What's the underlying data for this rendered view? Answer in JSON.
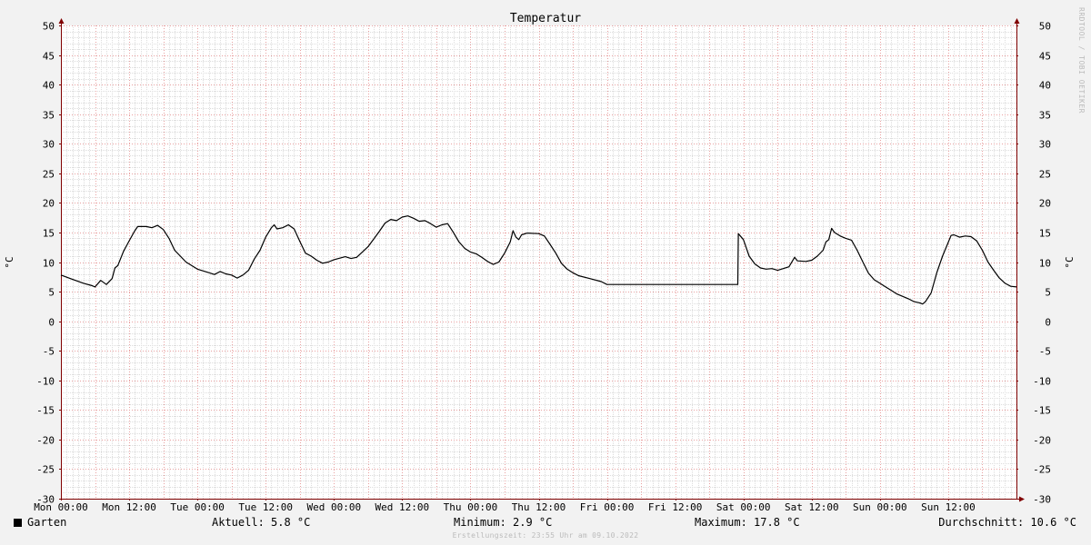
{
  "chart_data": {
    "type": "line",
    "title": "Temperatur",
    "ylabel": "°C",
    "ylabel_right": "°C",
    "ylim": [
      -30,
      50
    ],
    "y_ticks": [
      50,
      45,
      40,
      35,
      30,
      25,
      20,
      15,
      10,
      5,
      0,
      -5,
      -10,
      -15,
      -20,
      -25,
      -30
    ],
    "xlim": [
      0,
      168
    ],
    "x_ticks": [
      {
        "x": 0,
        "label": "Mon 00:00"
      },
      {
        "x": 12,
        "label": "Mon 12:00"
      },
      {
        "x": 24,
        "label": "Tue 00:00"
      },
      {
        "x": 36,
        "label": "Tue 12:00"
      },
      {
        "x": 48,
        "label": "Wed 00:00"
      },
      {
        "x": 60,
        "label": "Wed 12:00"
      },
      {
        "x": 72,
        "label": "Thu 00:00"
      },
      {
        "x": 84,
        "label": "Thu 12:00"
      },
      {
        "x": 96,
        "label": "Fri 00:00"
      },
      {
        "x": 108,
        "label": "Fri 12:00"
      },
      {
        "x": 120,
        "label": "Sat 00:00"
      },
      {
        "x": 132,
        "label": "Sat 12:00"
      },
      {
        "x": 144,
        "label": "Sun 00:00"
      },
      {
        "x": 156,
        "label": "Sun 12:00"
      }
    ],
    "grid": true,
    "series": [
      {
        "name": "Garten",
        "color": "#000000",
        "points": [
          [
            0,
            7.8
          ],
          [
            2,
            7.1
          ],
          [
            4,
            6.4
          ],
          [
            5.5,
            6.0
          ],
          [
            6,
            5.8
          ],
          [
            7,
            6.9
          ],
          [
            8,
            6.2
          ],
          [
            9,
            7.2
          ],
          [
            9.5,
            9.0
          ],
          [
            10,
            9.4
          ],
          [
            11,
            11.8
          ],
          [
            12,
            13.6
          ],
          [
            13,
            15.3
          ],
          [
            13.5,
            16.0
          ],
          [
            15,
            16.0
          ],
          [
            16,
            15.8
          ],
          [
            17,
            16.2
          ],
          [
            18,
            15.5
          ],
          [
            19,
            14.0
          ],
          [
            20,
            12.0
          ],
          [
            22,
            10.0
          ],
          [
            24,
            8.8
          ],
          [
            26,
            8.2
          ],
          [
            27,
            7.9
          ],
          [
            28,
            8.4
          ],
          [
            29,
            8.0
          ],
          [
            30,
            7.8
          ],
          [
            31,
            7.3
          ],
          [
            32,
            7.8
          ],
          [
            33,
            8.6
          ],
          [
            34,
            10.5
          ],
          [
            35,
            12.0
          ],
          [
            36,
            14.2
          ],
          [
            37,
            15.8
          ],
          [
            37.5,
            16.3
          ],
          [
            38,
            15.6
          ],
          [
            39,
            15.8
          ],
          [
            40,
            16.3
          ],
          [
            41,
            15.6
          ],
          [
            42,
            13.5
          ],
          [
            43,
            11.5
          ],
          [
            44,
            11.0
          ],
          [
            45,
            10.3
          ],
          [
            46,
            9.8
          ],
          [
            47,
            10.0
          ],
          [
            48,
            10.4
          ],
          [
            50,
            10.9
          ],
          [
            51,
            10.6
          ],
          [
            52,
            10.8
          ],
          [
            53,
            11.7
          ],
          [
            54,
            12.6
          ],
          [
            55,
            13.9
          ],
          [
            56,
            15.2
          ],
          [
            57,
            16.6
          ],
          [
            58,
            17.2
          ],
          [
            59,
            17.0
          ],
          [
            60,
            17.6
          ],
          [
            61,
            17.8
          ],
          [
            62,
            17.4
          ],
          [
            63,
            16.9
          ],
          [
            64,
            17.0
          ],
          [
            65,
            16.5
          ],
          [
            66,
            15.9
          ],
          [
            67,
            16.3
          ],
          [
            68,
            16.5
          ],
          [
            69,
            15.0
          ],
          [
            70,
            13.4
          ],
          [
            71,
            12.3
          ],
          [
            72,
            11.7
          ],
          [
            73,
            11.4
          ],
          [
            74,
            10.8
          ],
          [
            75,
            10.1
          ],
          [
            76,
            9.6
          ],
          [
            77,
            10.0
          ],
          [
            78,
            11.5
          ],
          [
            79,
            13.4
          ],
          [
            79.5,
            15.3
          ],
          [
            80,
            14.2
          ],
          [
            80.5,
            13.8
          ],
          [
            81,
            14.6
          ],
          [
            82,
            14.9
          ],
          [
            84,
            14.8
          ],
          [
            85,
            14.4
          ],
          [
            86,
            13.0
          ],
          [
            87,
            11.5
          ],
          [
            88,
            9.8
          ],
          [
            89,
            8.8
          ],
          [
            90,
            8.2
          ],
          [
            91,
            7.7
          ],
          [
            93,
            7.2
          ],
          [
            95,
            6.7
          ],
          [
            96,
            6.2
          ],
          [
            119,
            6.2
          ],
          [
            119.1,
            14.8
          ],
          [
            120,
            13.8
          ],
          [
            121,
            11.0
          ],
          [
            122,
            9.7
          ],
          [
            123,
            9.0
          ],
          [
            124,
            8.8
          ],
          [
            125,
            8.9
          ],
          [
            126,
            8.6
          ],
          [
            127,
            8.9
          ],
          [
            128,
            9.2
          ],
          [
            129,
            10.8
          ],
          [
            129.5,
            10.2
          ],
          [
            131,
            10.1
          ],
          [
            132,
            10.3
          ],
          [
            133,
            11.0
          ],
          [
            134,
            12.0
          ],
          [
            134.5,
            13.4
          ],
          [
            135,
            13.8
          ],
          [
            135.5,
            15.7
          ],
          [
            136,
            15.0
          ],
          [
            137,
            14.4
          ],
          [
            138,
            14.0
          ],
          [
            139,
            13.7
          ],
          [
            140,
            12.0
          ],
          [
            141,
            10.0
          ],
          [
            142,
            8.1
          ],
          [
            143,
            7.0
          ],
          [
            144,
            6.4
          ],
          [
            145,
            5.8
          ],
          [
            146,
            5.2
          ],
          [
            147,
            4.6
          ],
          [
            148,
            4.2
          ],
          [
            149,
            3.8
          ],
          [
            150,
            3.3
          ],
          [
            151,
            3.1
          ],
          [
            151.5,
            2.9
          ],
          [
            152,
            3.3
          ],
          [
            153,
            4.8
          ],
          [
            154,
            8.2
          ],
          [
            155,
            11.0
          ],
          [
            156,
            13.3
          ],
          [
            156.5,
            14.5
          ],
          [
            157,
            14.6
          ],
          [
            158,
            14.2
          ],
          [
            159,
            14.4
          ],
          [
            160,
            14.3
          ],
          [
            161,
            13.6
          ],
          [
            162,
            12.0
          ],
          [
            163,
            10.0
          ],
          [
            164,
            8.6
          ],
          [
            165,
            7.3
          ],
          [
            166,
            6.4
          ],
          [
            167,
            5.9
          ],
          [
            168,
            5.8
          ]
        ]
      }
    ]
  },
  "footer": {
    "legend_label": "Garten",
    "current": "Aktuell: 5.8 °C",
    "minimum": "Minimum: 2.9 °C",
    "maximum": "Maximum: 17.8 °C",
    "average": "Durchschnitt: 10.6 °C",
    "footnote": "Erstellungszeit: 23:55 Uhr am 09.10.2022"
  },
  "watermark": "RRDTOOL / TOBI OETIKER",
  "colors": {
    "background": "#f2f2f2",
    "plot_background": "#ffffff",
    "minor_grid": "#dcdcdc",
    "major_grid": "#e8a0a0",
    "axis": "#800000",
    "line": "#000000"
  }
}
